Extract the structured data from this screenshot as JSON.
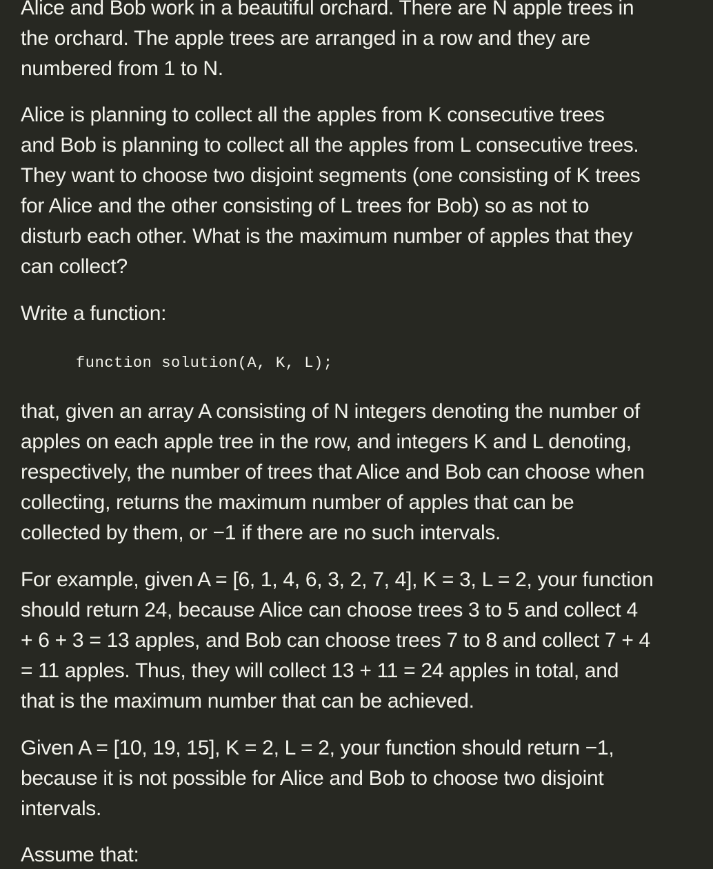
{
  "paragraphs": {
    "p1": [
      "Alice and Bob work in a beautiful orchard. There are N apple trees in",
      "the orchard. The apple trees are arranged in a row and they are",
      "numbered from 1 to N."
    ],
    "p2": [
      "Alice is planning to collect all the apples from K consecutive trees",
      "and Bob is planning to collect all the apples from L consecutive trees.",
      "They want to choose two disjoint segments (one consisting of K trees",
      "for Alice and the other consisting of L trees for Bob) so as not to",
      "disturb each other. What is the maximum number of apples that they",
      "can collect?"
    ],
    "p3": [
      "Write a function:"
    ],
    "p4": [
      "that, given an array A consisting of N integers denoting the number of",
      "apples on each apple tree in the row, and integers K and L denoting,",
      "respectively, the number of trees that Alice and Bob can choose when",
      "collecting, returns the maximum number of apples that can be",
      "collected by them, or −1 if there are no such intervals."
    ],
    "p5": [
      "For example, given A = [6, 1, 4, 6, 3, 2, 7, 4], K = 3, L = 2, your function",
      "should return 24, because Alice can choose trees 3 to 5 and collect 4",
      "+ 6 + 3 = 13 apples, and Bob can choose trees 7 to 8 and collect 7 + 4",
      "= 11 apples. Thus, they will collect 13 + 11 = 24 apples in total, and",
      "that is the maximum number that can be achieved."
    ],
    "p6": [
      "Given A = [10, 19, 15], K = 2, L = 2, your function should return −1,",
      "because it is not possible for Alice and Bob to choose two disjoint",
      "intervals."
    ],
    "p7": [
      "Assume that:"
    ]
  },
  "code": {
    "signature": "function solution(A, K, L);"
  }
}
